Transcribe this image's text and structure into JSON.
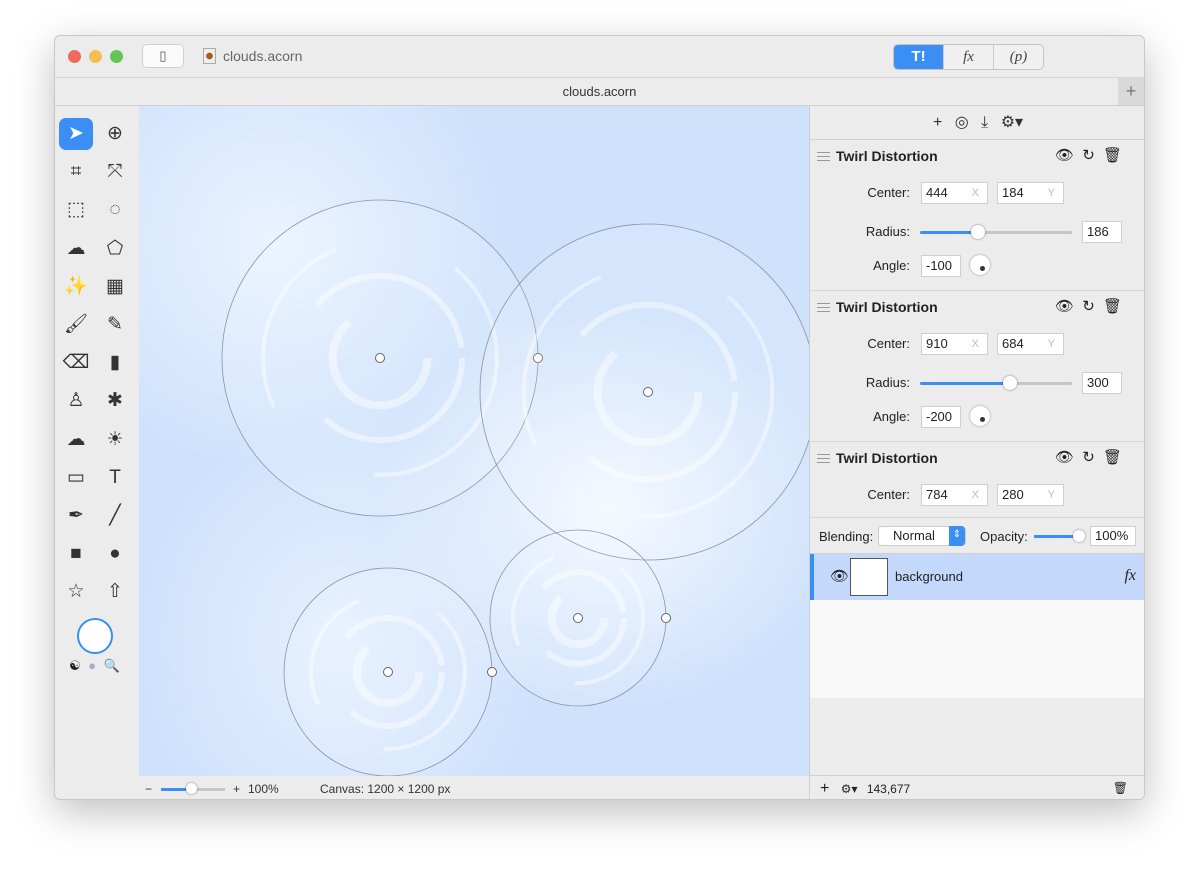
{
  "window": {
    "title": "clouds.acorn",
    "tab_title": "clouds.acorn"
  },
  "modes": [
    {
      "label": "T!",
      "icon": "tools-icon"
    },
    {
      "label": "fx",
      "icon": "filters-icon"
    },
    {
      "label": "(p)",
      "icon": "shapes-icon"
    }
  ],
  "tools": [
    {
      "name": "move-tool",
      "g": "➤"
    },
    {
      "name": "zoom-tool",
      "g": "⊕"
    },
    {
      "name": "crop-tool",
      "g": "⌗"
    },
    {
      "name": "resize-tool",
      "g": "⤧"
    },
    {
      "name": "rect-select-tool",
      "g": "⬚"
    },
    {
      "name": "ellipse-select-tool",
      "g": "◌"
    },
    {
      "name": "lasso-tool",
      "g": "☁"
    },
    {
      "name": "polygon-lasso-tool",
      "g": "⬠"
    },
    {
      "name": "magic-wand-tool",
      "g": "✨"
    },
    {
      "name": "instant-alpha-tool",
      "g": "▦"
    },
    {
      "name": "brush-tool",
      "g": "🖌"
    },
    {
      "name": "pencil-tool",
      "g": "✎"
    },
    {
      "name": "eraser-tool",
      "g": "⌫"
    },
    {
      "name": "fill-tool",
      "g": "▮"
    },
    {
      "name": "clone-tool",
      "g": "♙"
    },
    {
      "name": "smudge-tool",
      "g": "✱"
    },
    {
      "name": "cloud-tool",
      "g": "☁"
    },
    {
      "name": "light-tool",
      "g": "☀"
    },
    {
      "name": "gradient-tool",
      "g": "▭"
    },
    {
      "name": "text-tool",
      "g": "T"
    },
    {
      "name": "bezier-pen-tool",
      "g": "✒"
    },
    {
      "name": "line-tool",
      "g": "╱"
    },
    {
      "name": "rectangle-tool",
      "g": "■"
    },
    {
      "name": "oval-tool",
      "g": "●"
    },
    {
      "name": "star-tool",
      "g": "☆"
    },
    {
      "name": "arrow-tool",
      "g": "⇧"
    }
  ],
  "status": {
    "zoom": "100%",
    "canvas": "Canvas: 1200 × 1200 px"
  },
  "filters": [
    {
      "title": "Twirl Distortion",
      "center_label": "Center:",
      "x": "444",
      "y": "184",
      "radius_label": "Radius:",
      "radius": "186",
      "radius_pct": 38,
      "angle_label": "Angle:",
      "angle": "-100"
    },
    {
      "title": "Twirl Distortion",
      "center_label": "Center:",
      "x": "910",
      "y": "684",
      "radius_label": "Radius:",
      "radius": "300",
      "radius_pct": 59,
      "angle_label": "Angle:",
      "angle": "-200"
    },
    {
      "title": "Twirl Distortion",
      "center_label": "Center:",
      "x": "784",
      "y": "280"
    }
  ],
  "axis": {
    "x": "X",
    "y": "Y"
  },
  "layer_controls": {
    "blending_label": "Blending:",
    "blending": "Normal",
    "opacity_label": "Opacity:",
    "opacity": "100%",
    "opacity_pct": 100
  },
  "layers": [
    {
      "name": "background",
      "fx": "fx"
    }
  ],
  "footer": {
    "count": "143,677"
  },
  "colors": {
    "accent": "#3b8ef3",
    "selection": "#c3d8fb"
  }
}
